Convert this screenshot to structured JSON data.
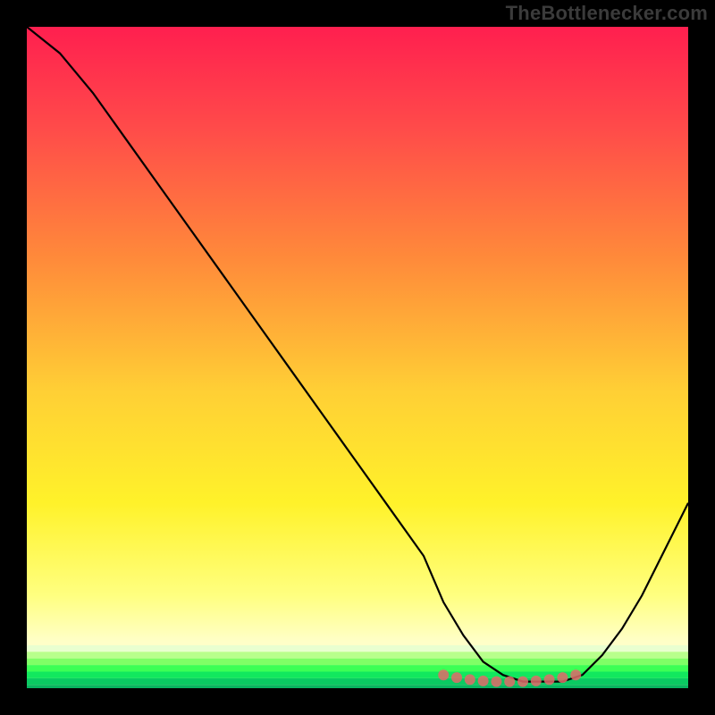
{
  "watermark": "TheBottlenecker.com",
  "chart_data": {
    "type": "line",
    "title": "",
    "xlabel": "",
    "ylabel": "",
    "xlim": [
      0,
      100
    ],
    "ylim": [
      0,
      100
    ],
    "x": [
      0,
      5,
      10,
      15,
      20,
      25,
      30,
      35,
      40,
      45,
      50,
      55,
      60,
      63,
      66,
      69,
      72,
      75,
      78,
      81,
      84,
      87,
      90,
      93,
      96,
      100
    ],
    "values": [
      100,
      96,
      90,
      83,
      76,
      69,
      62,
      55,
      48,
      41,
      34,
      27,
      20,
      13,
      8,
      4,
      2,
      1,
      1,
      1,
      2,
      5,
      9,
      14,
      20,
      28
    ],
    "markers": {
      "x": [
        63,
        65,
        67,
        69,
        71,
        73,
        75,
        77,
        79,
        81,
        83
      ],
      "y": [
        2.0,
        1.6,
        1.3,
        1.1,
        1.0,
        1.0,
        1.0,
        1.1,
        1.3,
        1.6,
        2.0
      ]
    },
    "gradient_stops": [
      {
        "offset": 0.0,
        "color": "#ff1f4f"
      },
      {
        "offset": 0.15,
        "color": "#ff4a4a"
      },
      {
        "offset": 0.35,
        "color": "#ff8a3a"
      },
      {
        "offset": 0.55,
        "color": "#ffcf35"
      },
      {
        "offset": 0.72,
        "color": "#fff22a"
      },
      {
        "offset": 0.86,
        "color": "#ffff80"
      },
      {
        "offset": 0.93,
        "color": "#ffffc8"
      }
    ],
    "green_bands": [
      {
        "offset": 0.935,
        "color": "#e9ffd0"
      },
      {
        "offset": 0.945,
        "color": "#b8ff8c"
      },
      {
        "offset": 0.955,
        "color": "#7fff66"
      },
      {
        "offset": 0.965,
        "color": "#3cff55"
      },
      {
        "offset": 0.975,
        "color": "#12e85e"
      },
      {
        "offset": 0.985,
        "color": "#0acb62"
      },
      {
        "offset": 0.995,
        "color": "#08b560"
      }
    ]
  }
}
